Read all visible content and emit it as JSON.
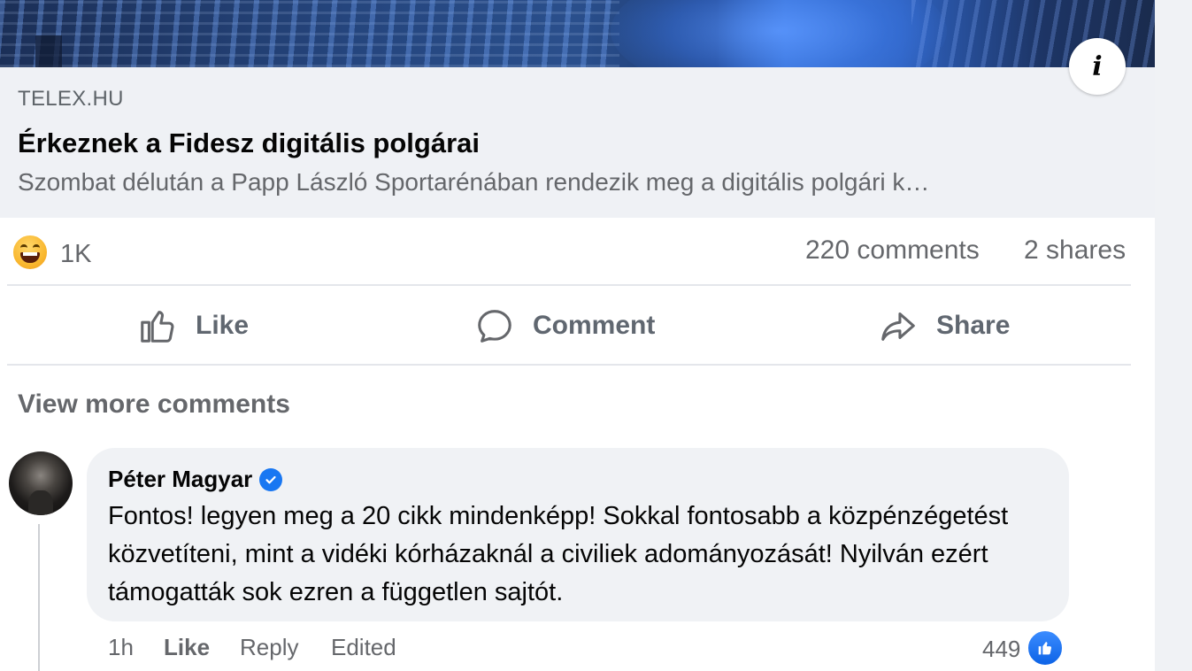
{
  "link_preview": {
    "domain": "TELEX.HU",
    "title": "Érkeznek a Fidesz digitális polgárai",
    "description": "Szombat délután a Papp László Sportarénában rendezik meg a digitális polgári k…"
  },
  "stats": {
    "reaction_count": "1K",
    "comments": "220 comments",
    "shares": "2 shares",
    "reaction_icon": "haha-emoji-icon"
  },
  "actions": {
    "like": "Like",
    "comment": "Comment",
    "share": "Share"
  },
  "view_more": "View more comments",
  "comment": {
    "author": "Péter Magyar",
    "text": "Fontos! legyen meg a 20 cikk mindenképp! Sokkal fontosabb a közpénzégetést közvetíteni, mint a vidéki kórházaknál a civiliek adományozását! Nyilván ezért támogatták sok ezren a független sajtót.",
    "time": "1h",
    "like_label": "Like",
    "reply_label": "Reply",
    "edited_label": "Edited",
    "like_count": "449"
  },
  "colors": {
    "accent": "#1877f2",
    "secondary_text": "#65676b",
    "bubble": "#f0f2f5"
  }
}
